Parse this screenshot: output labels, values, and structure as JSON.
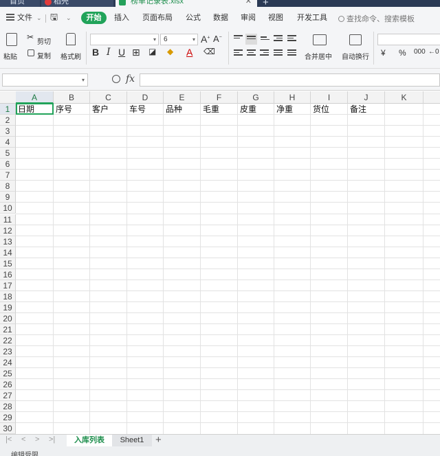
{
  "tabs": [
    {
      "label": "首页"
    },
    {
      "label": "稻壳"
    },
    {
      "label": "榜单记录表.xlsx"
    }
  ],
  "menu": {
    "file": "文件",
    "items": [
      "开始",
      "插入",
      "页面布局",
      "公式",
      "数据",
      "审阅",
      "视图",
      "开发工具"
    ],
    "search_placeholder": "查找命令、搜索模板"
  },
  "ribbon": {
    "paste": "粘贴",
    "cut": "剪切",
    "copy": "复制",
    "format_painter": "格式刷",
    "font_size": "6",
    "merge_center": "合并居中",
    "wrap_text": "自动换行",
    "currency_symbol": "¥",
    "percent_symbol": "%"
  },
  "formula": {
    "fx": "fx"
  },
  "columns": [
    "A",
    "B",
    "C",
    "D",
    "E",
    "F",
    "G",
    "H",
    "I",
    "J",
    "K"
  ],
  "rows": [
    "1",
    "2",
    "3",
    "4",
    "5",
    "6",
    "7",
    "8",
    "9",
    "10",
    "11",
    "12",
    "13",
    "14",
    "15",
    "16",
    "17",
    "18",
    "19",
    "20",
    "21",
    "22",
    "23",
    "24",
    "25",
    "26",
    "27",
    "28",
    "29",
    "30"
  ],
  "header_cells": [
    "日期",
    "序号",
    "客户",
    "车号",
    "品种",
    "毛重",
    "皮重",
    "净重",
    "货位",
    "备注"
  ],
  "sheets": [
    {
      "label": "入库列表"
    },
    {
      "label": "Sheet1"
    }
  ],
  "status": "编辑受限",
  "colors": {
    "accent": "#21a35a",
    "titlebar": "#2b3a55"
  }
}
